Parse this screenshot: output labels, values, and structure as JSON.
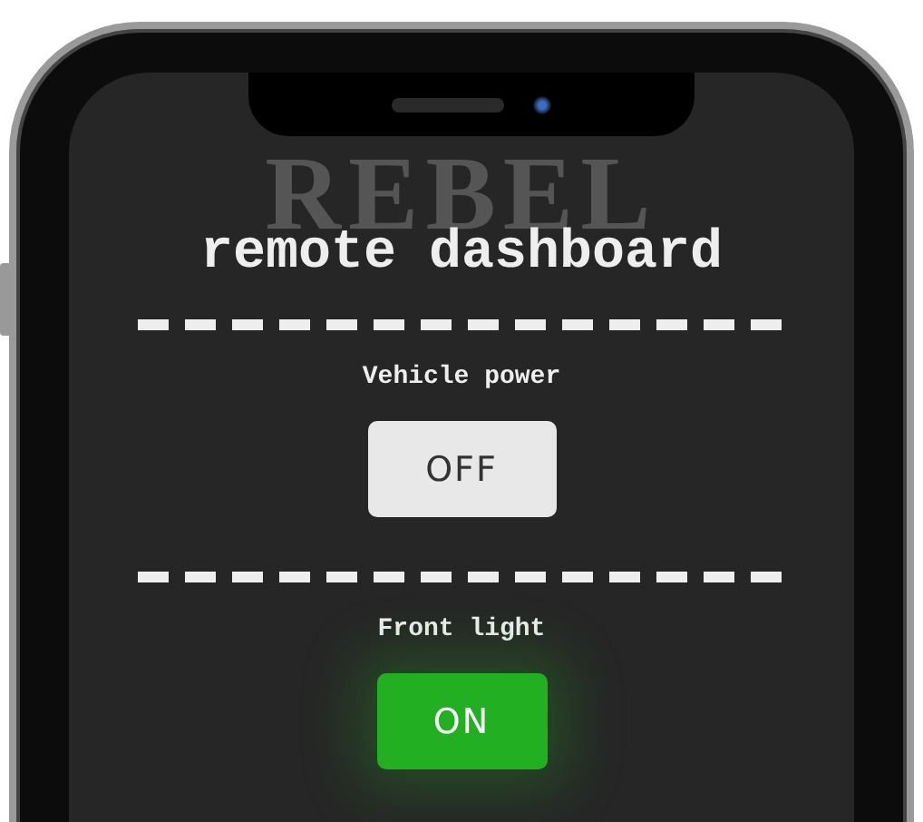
{
  "logo_text": "REBEL",
  "title": "remote dashboard",
  "controls": [
    {
      "label": "Vehicle power",
      "button": "OFF",
      "on": false
    },
    {
      "label": "Front light",
      "button": "ON",
      "on": true
    }
  ]
}
